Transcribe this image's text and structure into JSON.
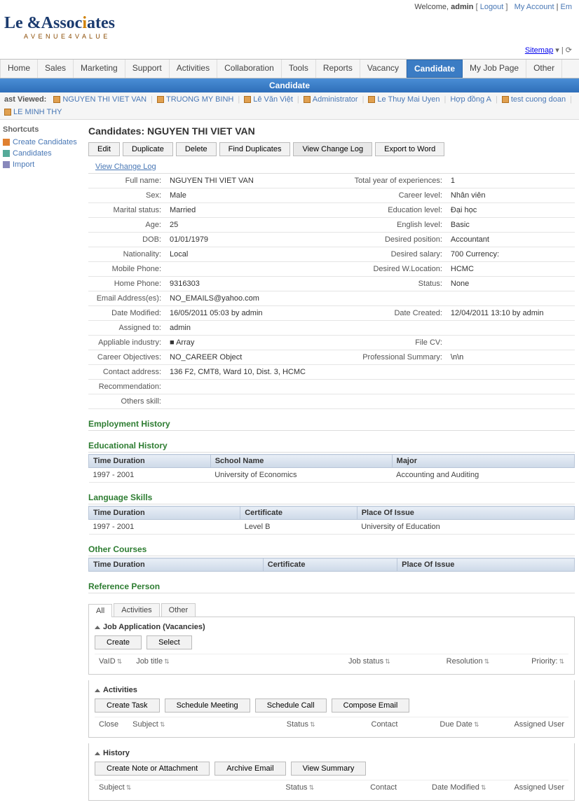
{
  "header": {
    "welcome": "Welcome, ",
    "user": "admin",
    "logout": "Logout",
    "myAccount": "My Account",
    "em": "Em",
    "sitemap": "Sitemap"
  },
  "logo": {
    "main": "Le &Associates",
    "sub": "A  V E N U E  4  V A L U E"
  },
  "nav": {
    "tabs": [
      "Home",
      "Sales",
      "Marketing",
      "Support",
      "Activities",
      "Collaboration",
      "Tools",
      "Reports",
      "Vacancy",
      "Candidate",
      "My Job Page",
      "Other"
    ],
    "active": "Candidate",
    "sub": "Candidate"
  },
  "lastViewed": {
    "label": "ast Viewed:",
    "items": [
      "NGUYEN THI VIET VAN",
      "TRUONG MY BINH",
      "Lê Văn Việt",
      "Administrator",
      "Le Thuy Mai Uyen",
      "Hợp đồng A",
      "test cuong doan",
      "LE MINH THY"
    ]
  },
  "shortcuts": {
    "title": "Shortcuts",
    "items": [
      "Create Candidates",
      "Candidates",
      "Import"
    ]
  },
  "pageTitle": "Candidates: NGUYEN THI VIET VAN",
  "actions": [
    "Edit",
    "Duplicate",
    "Delete",
    "Find Duplicates",
    "View Change Log",
    "Export to Word"
  ],
  "viewChangeLog": "View Change Log",
  "details": {
    "left": [
      [
        "Full name:",
        "NGUYEN THI VIET VAN"
      ],
      [
        "Sex:",
        "Male"
      ],
      [
        "Marital status:",
        "Married"
      ],
      [
        "Age:",
        "25"
      ],
      [
        "DOB:",
        "01/01/1979"
      ],
      [
        "Nationality:",
        "Local"
      ],
      [
        "Mobile Phone:",
        ""
      ],
      [
        "Home Phone:",
        "9316303"
      ],
      [
        "Email Address(es):",
        "NO_EMAILS@yahoo.com"
      ],
      [
        "Date Modified:",
        "16/05/2011 05:03 by admin"
      ],
      [
        "Assigned to:",
        "admin"
      ],
      [
        "Appliable industry:",
        "■ Array"
      ],
      [
        "Career Objectives:",
        "NO_CAREER Object"
      ],
      [
        "Contact address:",
        "136 F2, CMT8, Ward 10, Dist. 3, HCMC"
      ],
      [
        "Recommendation:",
        ""
      ],
      [
        "Others skill:",
        ""
      ]
    ],
    "right": [
      [
        "Total year of experiences:",
        "1"
      ],
      [
        "Career level:",
        "Nhân viên"
      ],
      [
        "Education level:",
        "Đại học"
      ],
      [
        "English level:",
        "Basic"
      ],
      [
        "Desired position:",
        "Accountant"
      ],
      [
        "Desired salary:",
        "700  Currency:"
      ],
      [
        "Desired W.Location:",
        "HCMC"
      ],
      [
        "Status:",
        "None"
      ],
      [
        "",
        ""
      ],
      [
        "Date Created:",
        "12/04/2011 13:10 by admin"
      ],
      [
        "",
        ""
      ],
      [
        "File CV:",
        ""
      ],
      [
        "Professional Summary:",
        "\\n\\n"
      ],
      [
        "",
        ""
      ],
      [
        "",
        ""
      ],
      [
        "",
        ""
      ]
    ]
  },
  "sections": {
    "employment": "Employment History",
    "educational": "Educational History",
    "language": "Language Skills",
    "other": "Other Courses",
    "reference": "Reference Person"
  },
  "eduHeaders": [
    "Time Duration",
    "School Name",
    "Major"
  ],
  "eduRows": [
    [
      "1997 - 2001",
      "University of Economics",
      "Accounting and Auditing"
    ]
  ],
  "langHeaders": [
    "Time Duration",
    "Certificate",
    "Place Of Issue"
  ],
  "langRows": [
    [
      "1997 - 2001",
      "Level B",
      "University of Education"
    ]
  ],
  "otherHeaders": [
    "Time Duration",
    "Certificate",
    "Place Of Issue"
  ],
  "subTabs": [
    "All",
    "Activities",
    "Other"
  ],
  "jobApp": {
    "title": "Job Application (Vacancies)",
    "buttons": [
      "Create",
      "Select"
    ],
    "cols": [
      "VaID",
      "Job title",
      "Job status",
      "Resolution",
      "Priority:"
    ]
  },
  "activities": {
    "title": "Activities",
    "buttons": [
      "Create Task",
      "Schedule Meeting",
      "Schedule Call",
      "Compose Email"
    ],
    "cols": [
      "Close",
      "Subject",
      "Status",
      "Contact",
      "Due Date",
      "Assigned User"
    ]
  },
  "history": {
    "title": "History",
    "buttons": [
      "Create Note or Attachment",
      "Archive Email",
      "View Summary"
    ],
    "cols": [
      "Subject",
      "Status",
      "Contact",
      "Date Modified",
      "Assigned User"
    ]
  }
}
